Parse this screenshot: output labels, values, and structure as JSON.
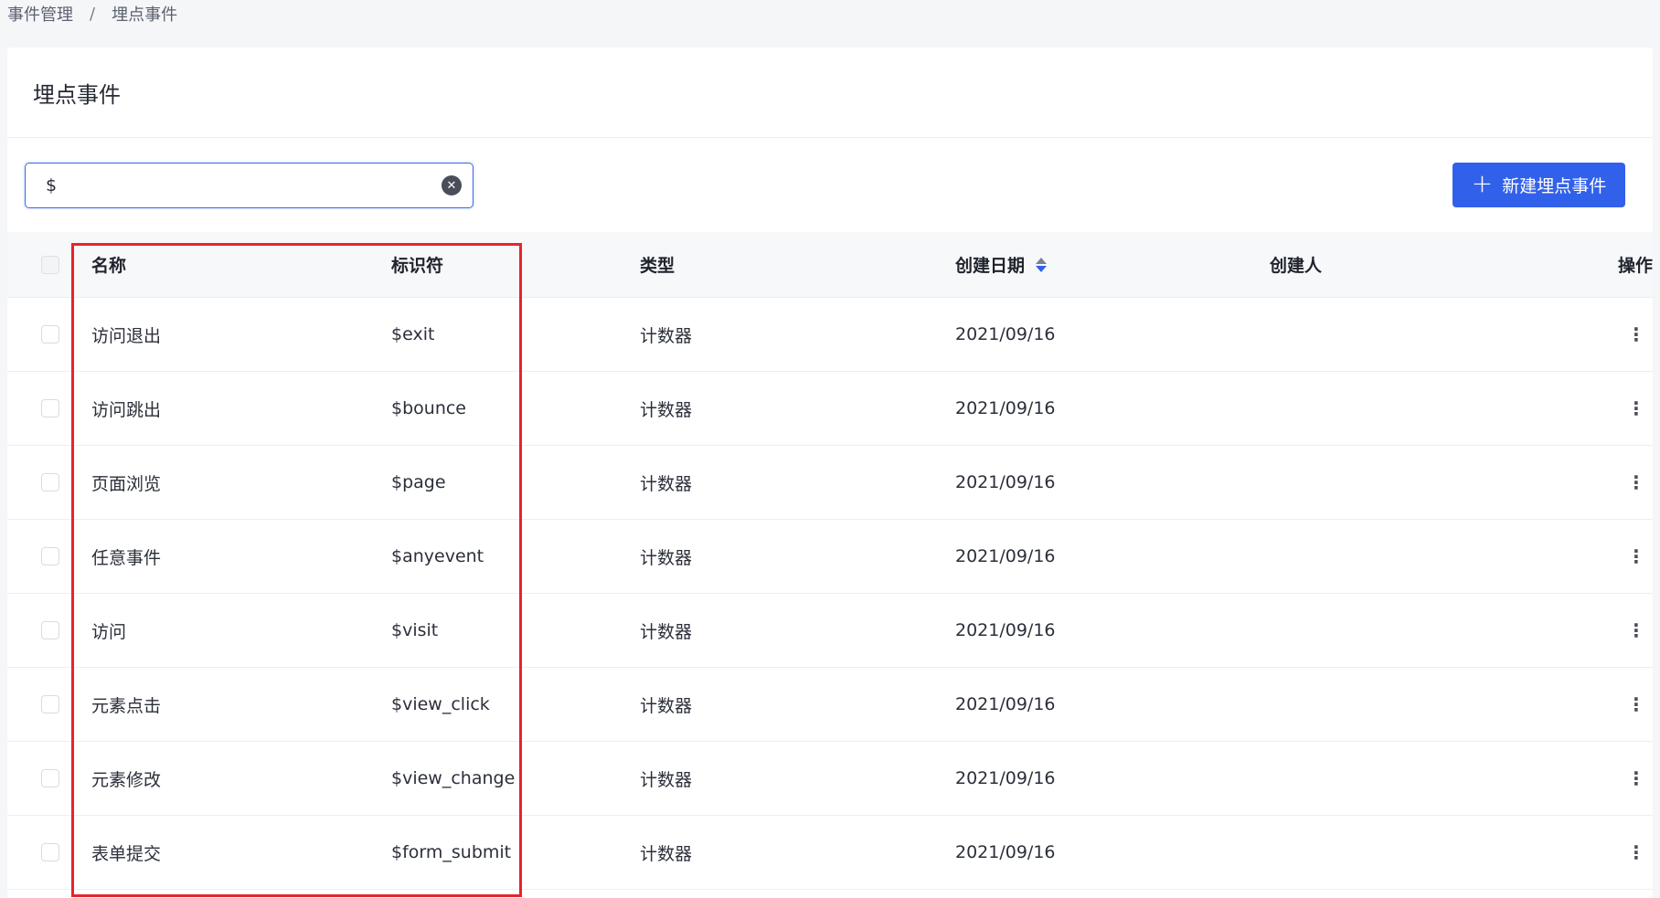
{
  "breadcrumb": {
    "parent": "事件管理",
    "separator": "/",
    "current": "埋点事件"
  },
  "page_title": "埋点事件",
  "search": {
    "value": "$"
  },
  "create_button": {
    "label": "新建埋点事件"
  },
  "table": {
    "columns": [
      "名称",
      "标识符",
      "类型",
      "创建日期",
      "创建人",
      "操作"
    ],
    "rows": [
      {
        "name": "访问退出",
        "identifier": "$exit",
        "type": "计数器",
        "date": "2021/09/16",
        "creator": ""
      },
      {
        "name": "访问跳出",
        "identifier": "$bounce",
        "type": "计数器",
        "date": "2021/09/16",
        "creator": ""
      },
      {
        "name": "页面浏览",
        "identifier": "$page",
        "type": "计数器",
        "date": "2021/09/16",
        "creator": ""
      },
      {
        "name": "任意事件",
        "identifier": "$anyevent",
        "type": "计数器",
        "date": "2021/09/16",
        "creator": ""
      },
      {
        "name": "访问",
        "identifier": "$visit",
        "type": "计数器",
        "date": "2021/09/16",
        "creator": ""
      },
      {
        "name": "元素点击",
        "identifier": "$view_click",
        "type": "计数器",
        "date": "2021/09/16",
        "creator": ""
      },
      {
        "name": "元素修改",
        "identifier": "$view_change",
        "type": "计数器",
        "date": "2021/09/16",
        "creator": ""
      },
      {
        "name": "表单提交",
        "identifier": "$form_submit",
        "type": "计数器",
        "date": "2021/09/16",
        "creator": ""
      }
    ]
  },
  "colors": {
    "accent": "#3161ea",
    "highlight": "#e8232b"
  },
  "icons": {
    "clear": "close-circle-icon",
    "create": "plus-icon",
    "sort": "sort-icon",
    "row_actions": "more-vertical-icon"
  }
}
